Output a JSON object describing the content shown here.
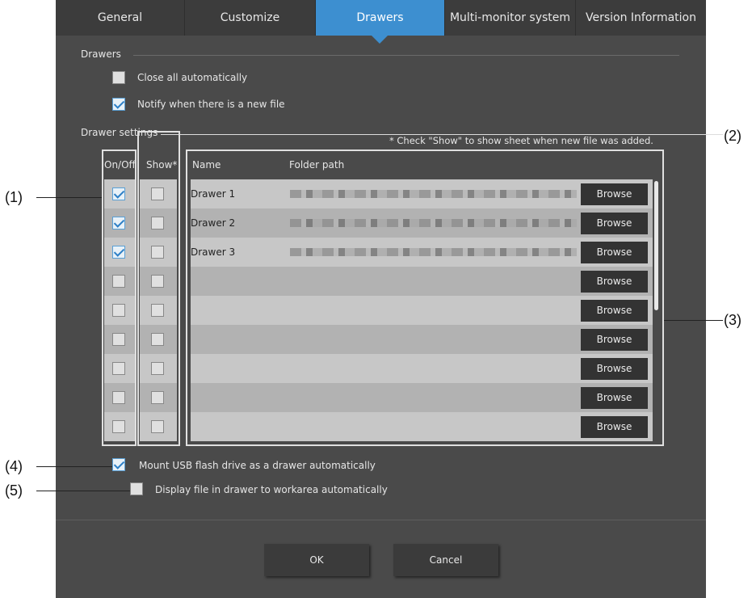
{
  "tabs": [
    {
      "label": "General",
      "active": false
    },
    {
      "label": "Customize",
      "active": false
    },
    {
      "label": "Drawers",
      "active": true
    },
    {
      "label": "Multi-monitor system",
      "active": false
    },
    {
      "label": "Version Information",
      "active": false
    }
  ],
  "drawers_section": {
    "title": "Drawers",
    "close_all": {
      "label": "Close all automatically",
      "checked": false
    },
    "notify": {
      "label": "Notify when there is a new file",
      "checked": true
    }
  },
  "drawer_settings": {
    "title": "Drawer settings",
    "note": "* Check \"Show\" to show sheet when new file was added.",
    "columns": {
      "on_off": "On/Off",
      "show": "Show*",
      "name": "Name",
      "folder_path": "Folder path"
    },
    "rows": [
      {
        "on": true,
        "show": false,
        "name": "Drawer 1",
        "browse": "Browse"
      },
      {
        "on": true,
        "show": false,
        "name": "Drawer 2",
        "browse": "Browse"
      },
      {
        "on": true,
        "show": false,
        "name": "Drawer 3",
        "browse": "Browse"
      },
      {
        "on": false,
        "show": false,
        "name": "",
        "browse": "Browse"
      },
      {
        "on": false,
        "show": false,
        "name": "",
        "browse": "Browse"
      },
      {
        "on": false,
        "show": false,
        "name": "",
        "browse": "Browse"
      },
      {
        "on": false,
        "show": false,
        "name": "",
        "browse": "Browse"
      },
      {
        "on": false,
        "show": false,
        "name": "",
        "browse": "Browse"
      },
      {
        "on": false,
        "show": false,
        "name": "",
        "browse": "Browse"
      }
    ]
  },
  "options": {
    "mount_usb": {
      "label": "Mount USB flash drive as a drawer automatically",
      "checked": true
    },
    "display_file": {
      "label": "Display file in drawer to workarea automatically",
      "checked": false
    }
  },
  "buttons": {
    "ok": "OK",
    "cancel": "Cancel"
  },
  "callouts": [
    "(1)",
    "(2)",
    "(3)",
    "(4)",
    "(5)"
  ],
  "colors": {
    "accent": "#3d8fd0",
    "panel": "#4a4a4a"
  }
}
